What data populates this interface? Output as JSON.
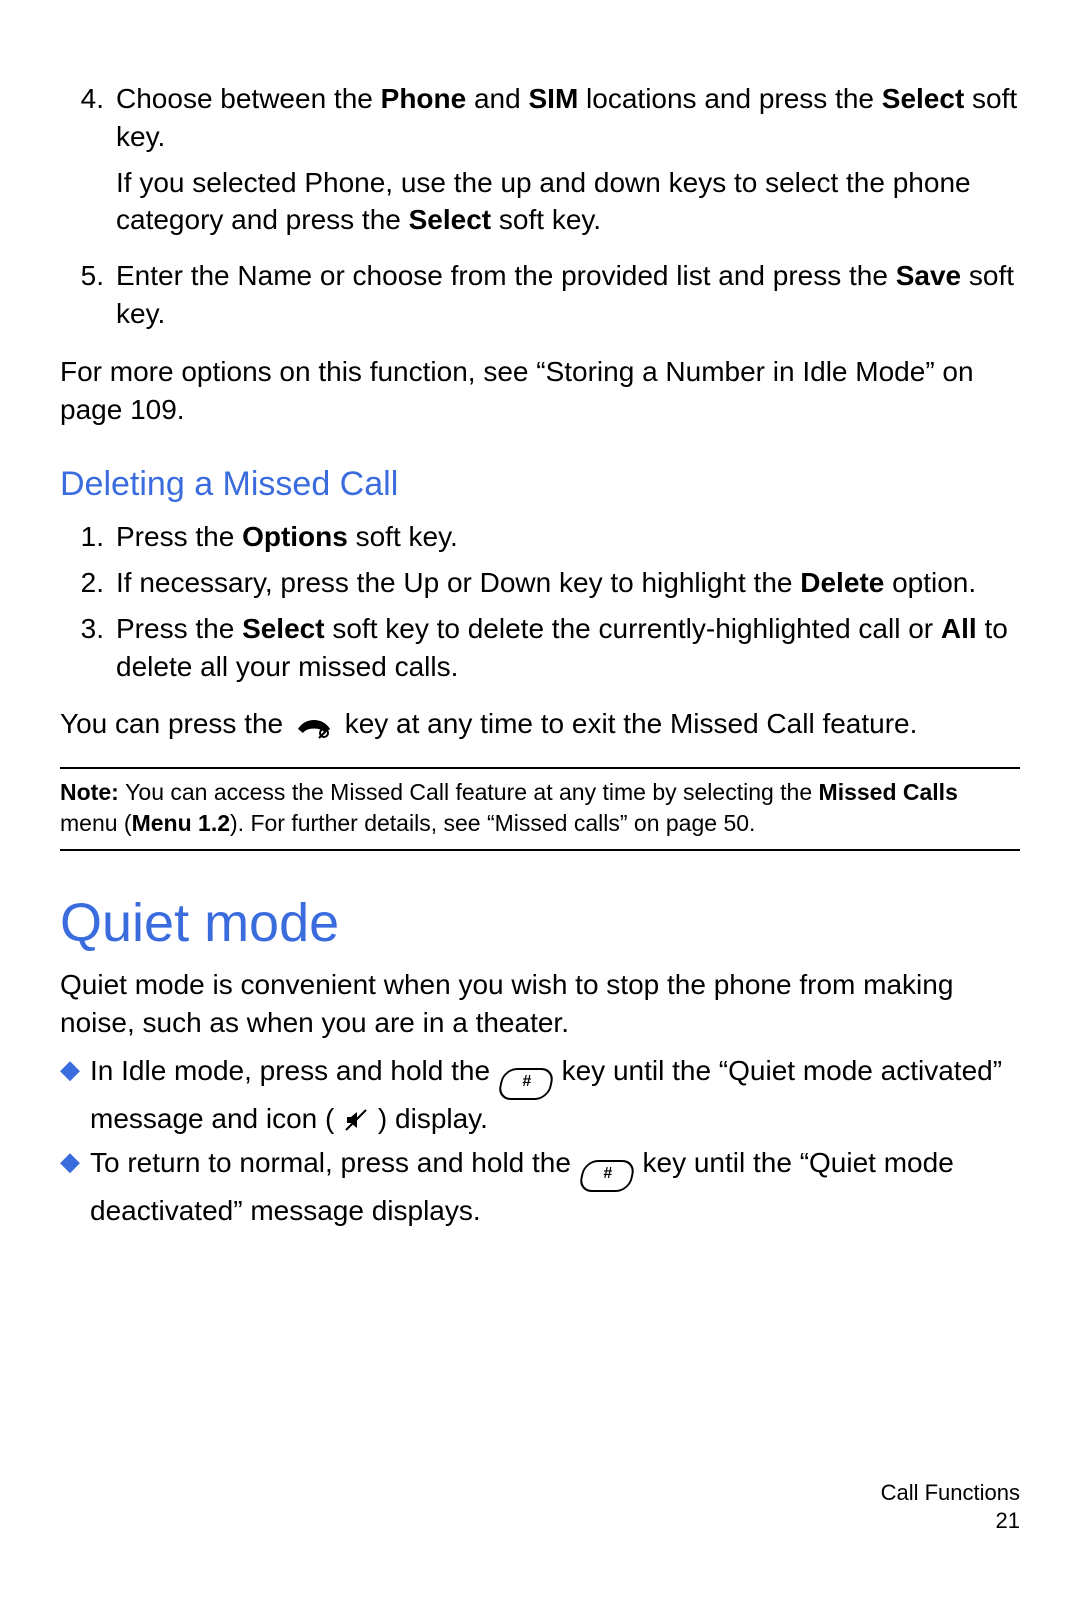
{
  "top_list": {
    "item4": {
      "num": "4.",
      "pre": "Choose between the ",
      "b1": "Phone",
      "mid1": " and ",
      "b2": "SIM",
      "mid2": " locations and press the ",
      "b3": "Select",
      "post": " soft key.",
      "sub_pre": "If you selected Phone, use the up and down keys to select the phone category and press the ",
      "sub_b": "Select",
      "sub_post": " soft key."
    },
    "item5": {
      "num": "5.",
      "pre": "Enter the Name or choose from the provided list and press the ",
      "b1": "Save",
      "post": " soft key."
    }
  },
  "for_more": "For more options on this function, see “Storing a Number in Idle Mode” on page 109.",
  "h2_delete": "Deleting a Missed Call",
  "del_list": {
    "item1": {
      "num": "1.",
      "pre": "Press the ",
      "b1": "Options",
      "post": " soft key."
    },
    "item2": {
      "num": "2.",
      "pre": "If necessary, press the Up or Down key to highlight the ",
      "b1": "Delete",
      "post": " option."
    },
    "item3": {
      "num": "3.",
      "pre": "Press the ",
      "b1": "Select",
      "mid1": " soft key to delete the currently-highlighted call or ",
      "b2": "All",
      "post": " to delete all your missed calls."
    }
  },
  "exit_pre": "You can press the ",
  "exit_post": " key at any time to exit the Missed Call feature.",
  "note": {
    "label": "Note: ",
    "pre": "You can access the Missed Call feature at any time by selecting the ",
    "b1": "Missed Calls",
    "mid1": " menu (",
    "b2": "Menu 1.2",
    "post": "). For further details, see “Missed calls” on page 50."
  },
  "h1_quiet": "Quiet mode",
  "quiet_intro": "Quiet mode is convenient when you wish to stop the phone from making noise, such as when you are in a theater.",
  "quiet_b1": {
    "pre": "In Idle mode, press and hold the ",
    "mid": " key until the “Quiet mode activated” message and icon ( ",
    "post": " ) display."
  },
  "quiet_b2": {
    "pre": "To return to normal, press and hold the ",
    "post": " key until the “Quiet mode deactivated” message displays."
  },
  "key_label": "#",
  "footer_section": "Call Functions",
  "footer_page": "21"
}
